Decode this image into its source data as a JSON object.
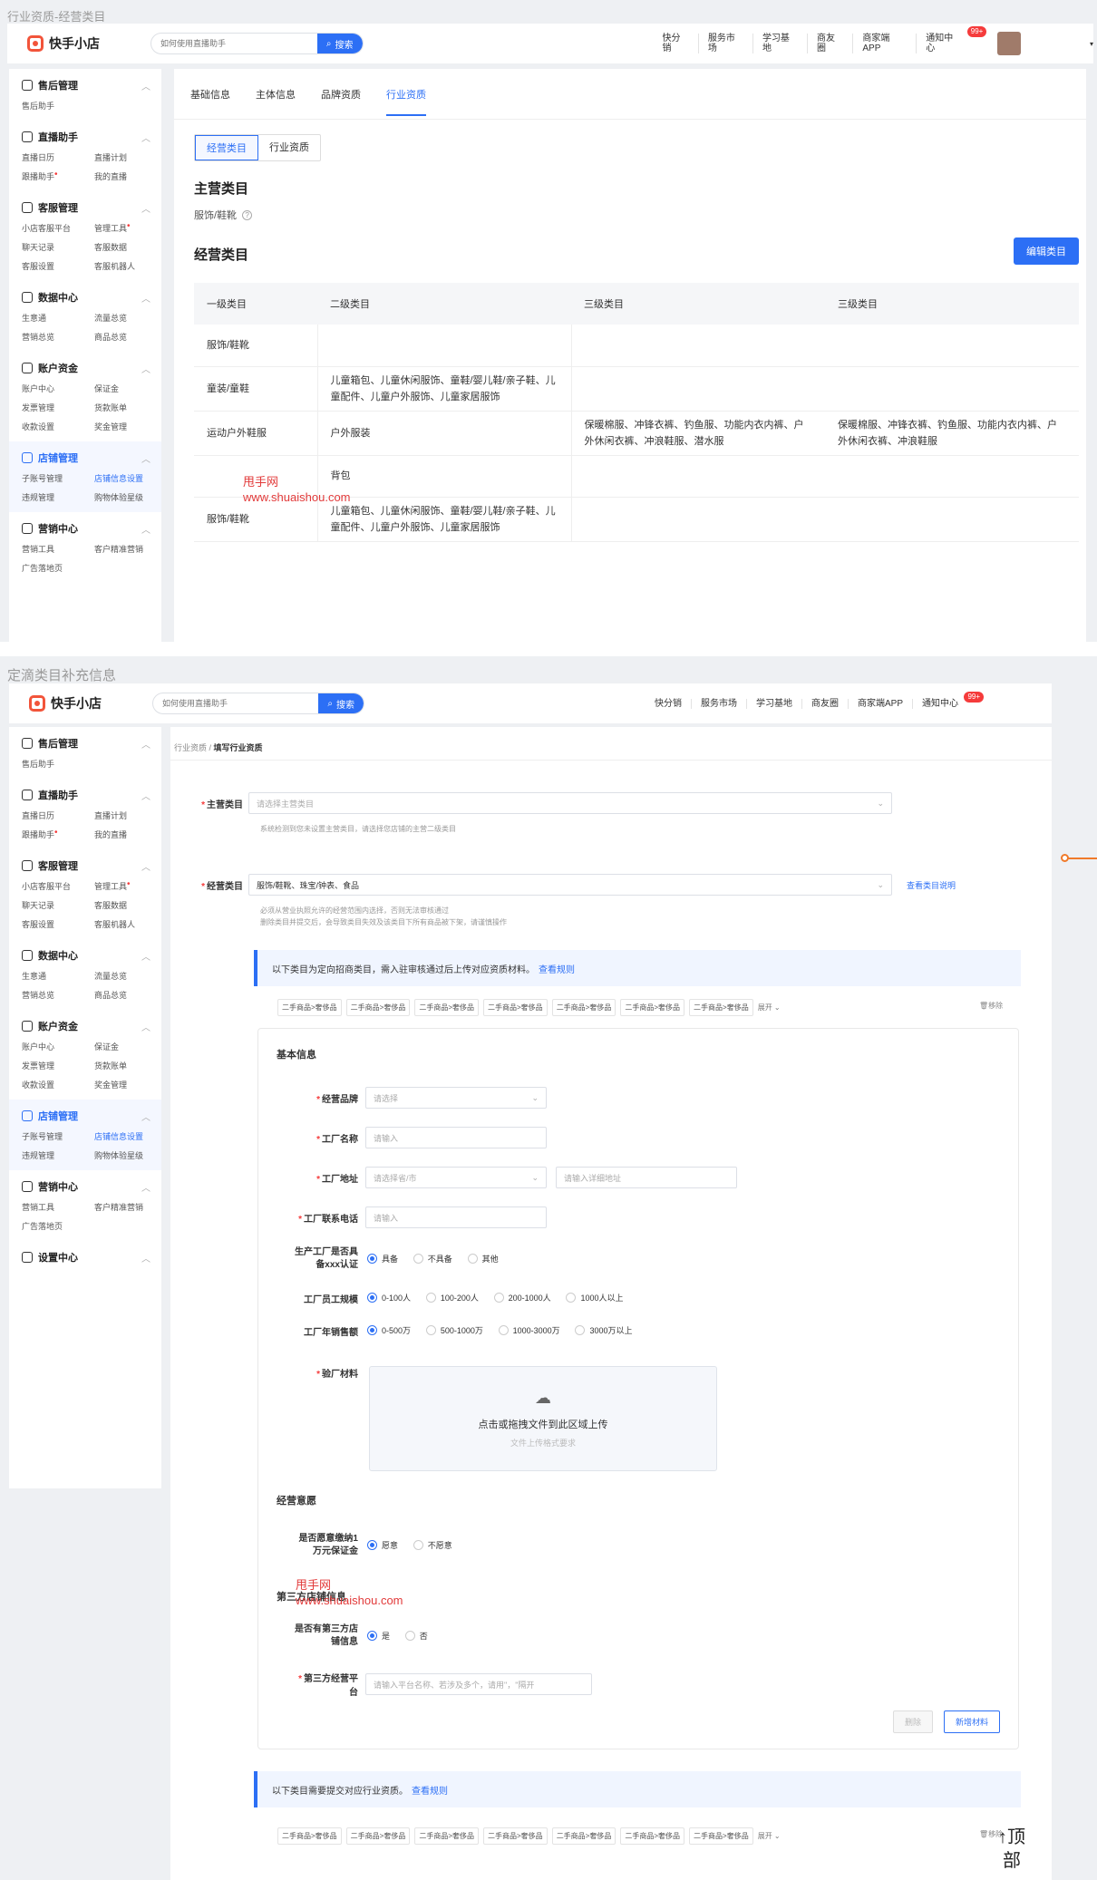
{
  "frame1": {
    "caption": "行业资质-经营类目",
    "header": {
      "brand": "快手小店",
      "search_placeholder": "如何使用直播助手",
      "search_button": "搜索",
      "nav": [
        "快分销",
        "服务市场",
        "学习基地",
        "商友圈",
        "商家端APP",
        "通知中心"
      ],
      "badge": "99+"
    },
    "sidebar": [
      {
        "title": "售后管理",
        "items": [
          "售后助手"
        ]
      },
      {
        "title": "直播助手",
        "items": [
          "直播日历",
          "直播计划",
          "跟播助手",
          "我的直播"
        ]
      },
      {
        "title": "客服管理",
        "items": [
          "小店客服平台",
          "管理工具",
          "聊天记录",
          "客服数据",
          "客服设置",
          "客服机器人"
        ]
      },
      {
        "title": "数据中心",
        "items": [
          "生意通",
          "流量总览",
          "营销总览",
          "商品总览"
        ]
      },
      {
        "title": "账户资金",
        "items": [
          "账户中心",
          "保证金",
          "发票管理",
          "货款账单",
          "收款设置",
          "奖金管理"
        ]
      },
      {
        "title": "店铺管理",
        "items": [
          "子账号管理",
          "店铺信息设置",
          "违规管理",
          "购物体验星级"
        ]
      },
      {
        "title": "营销中心",
        "items": [
          "营销工具",
          "客户精准营销",
          "广告落地页"
        ]
      }
    ],
    "tabs": [
      "基础信息",
      "主体信息",
      "品牌资质",
      "行业资质"
    ],
    "segment": [
      "经营类目",
      "行业资质"
    ],
    "main_category_title": "主营类目",
    "main_category_value": "服饰/鞋靴",
    "business_category_title": "经营类目",
    "edit_button": "编辑类目",
    "table": {
      "headers": [
        "一级类目",
        "二级类目",
        "三级类目",
        "三级类目"
      ],
      "rows": [
        [
          "服饰/鞋靴",
          "",
          "",
          ""
        ],
        [
          "童装/童鞋",
          "儿童箱包、儿童休闲服饰、童鞋/婴儿鞋/亲子鞋、儿童配件、儿童户外服饰、儿童家居服饰",
          "",
          ""
        ],
        [
          "运动户外鞋服",
          "户外服装",
          "保暖棉服、冲锋衣裤、钓鱼服、功能内衣内裤、户外休闲衣裤、冲浪鞋服、潜水服",
          "保暖棉服、冲锋衣裤、钓鱼服、功能内衣内裤、户外休闲衣裤、冲浪鞋服"
        ],
        [
          "",
          "背包",
          "",
          ""
        ],
        [
          "服饰/鞋靴",
          "儿童箱包、儿童休闲服饰、童鞋/婴儿鞋/亲子鞋、儿童配件、儿童户外服饰、儿童家居服饰",
          "",
          ""
        ]
      ]
    },
    "watermark": [
      "甩手网",
      "www.shuaishou.com"
    ]
  },
  "frame2": {
    "caption": "定滴类目补充信息",
    "header": {
      "brand": "快手小店",
      "search_placeholder": "如何使用直播助手",
      "search_button": "搜索",
      "nav": [
        "快分销",
        "服务市场",
        "学习基地",
        "商友圈",
        "商家端APP",
        "通知中心"
      ],
      "badge": "99+"
    },
    "sidebar": [
      {
        "title": "售后管理",
        "items": [
          "售后助手"
        ]
      },
      {
        "title": "直播助手",
        "items": [
          "直播日历",
          "直播计划",
          "跟播助手",
          "我的直播"
        ]
      },
      {
        "title": "客服管理",
        "items": [
          "小店客服平台",
          "管理工具",
          "聊天记录",
          "客服数据",
          "客服设置",
          "客服机器人"
        ]
      },
      {
        "title": "数据中心",
        "items": [
          "生意通",
          "流量总览",
          "营销总览",
          "商品总览"
        ]
      },
      {
        "title": "账户资金",
        "items": [
          "账户中心",
          "保证金",
          "发票管理",
          "货款账单",
          "收款设置",
          "奖金管理"
        ]
      },
      {
        "title": "店铺管理",
        "items": [
          "子账号管理",
          "店铺信息设置",
          "违规管理",
          "购物体验星级"
        ]
      },
      {
        "title": "营销中心",
        "items": [
          "营销工具",
          "客户精准营销",
          "广告落地页"
        ]
      },
      {
        "title": "设置中心",
        "items": []
      }
    ],
    "breadcrumb": [
      "行业资质",
      "填写行业资质"
    ],
    "main_category_label": "主营类目",
    "main_category_placeholder": "请选择主营类目",
    "main_category_hint": "系统检测到您未设置主营类目，请选择您店铺的主营二级类目",
    "business_category_label": "经营类目",
    "business_category_value": "服饰/鞋靴、珠宝/钟表、食品",
    "business_category_link": "查看类目说明",
    "business_category_hint1": "必须从营业执照允许的经营范围内选择，否则无法审核通过",
    "business_category_hint2": "删除类目并提交后，会导致类目失效及该类目下所有商品被下架，请谨慎操作",
    "notice1": "以下类目为定向招商类目，需入驻审核通过后上传对应资质材料。",
    "notice1_link": "查看规则",
    "chips": [
      "二手商品>奢侈品",
      "二手商品>奢侈品",
      "二手商品>奢侈品",
      "二手商品>奢侈品",
      "二手商品>奢侈品",
      "二手商品>奢侈品",
      "二手商品>奢侈品"
    ],
    "expand": "展开",
    "remove": "移除",
    "basic_info_title": "基本信息",
    "fields": {
      "brand_label": "经营品牌",
      "brand_placeholder": "请选择",
      "factory_name_label": "工厂名称",
      "factory_name_placeholder": "请输入",
      "factory_address_label": "工厂地址",
      "factory_address_select": "请选择省/市",
      "factory_address_placeholder": "请输入详细地址",
      "factory_phone_label": "工厂联系电话",
      "factory_phone_placeholder": "请输入",
      "cert_label": "生产工厂是否具备xxx认证",
      "cert_options": [
        "具备",
        "不具备",
        "其他"
      ],
      "staff_label": "工厂员工规模",
      "staff_options": [
        "0-100人",
        "100-200人",
        "200-1000人",
        "1000人以上"
      ],
      "sales_label": "工厂年销售额",
      "sales_options": [
        "0-500万",
        "500-1000万",
        "1000-3000万",
        "3000万以上"
      ],
      "material_label": "验厂材料",
      "upload_text": "点击或拖拽文件到此区域上传",
      "upload_hint": "文件上传格式要求"
    },
    "intent_title": "经营意愿",
    "deposit_label": "是否愿意缴纳1万元保证金",
    "deposit_options": [
      "愿意",
      "不愿意"
    ],
    "third_party_title": "第三方店铺信息",
    "third_party_has_label": "是否有第三方店铺信息",
    "third_party_options": [
      "是",
      "否"
    ],
    "third_party_platform_label": "第三方经营平台",
    "third_party_platform_placeholder": "请输入平台名称、若涉及多个，请用\"，\"隔开",
    "delete_button": "删除",
    "add_material_button": "新增材料",
    "notice2": "以下类目需要提交对应行业资质。",
    "notice2_link": "查看规则",
    "watermark": [
      "甩手网",
      "www.shuaishou.com"
    ],
    "to_top": "顶部"
  }
}
